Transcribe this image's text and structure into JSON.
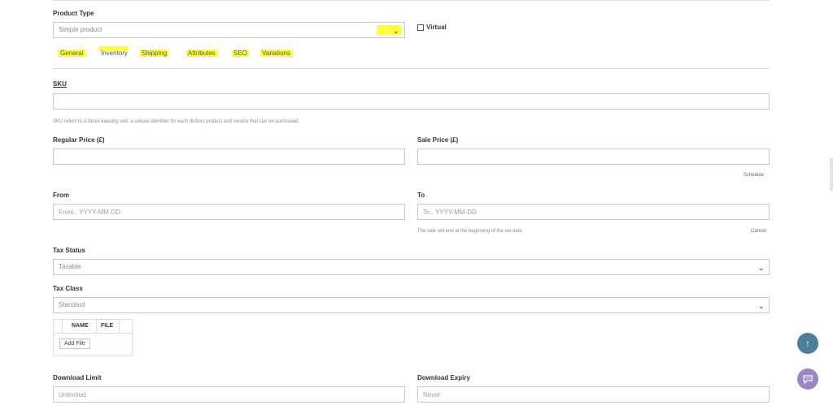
{
  "product_type": {
    "label": "Product Type",
    "value": "Simple product",
    "virtual_label": "Virtual"
  },
  "tabs": [
    "General",
    "Inventory",
    "Shipping",
    "Attributes",
    "SEO",
    "Variations"
  ],
  "sku": {
    "label": "SKU",
    "value": "",
    "help": "SKU refers to a Stock-keeping unit, a unique identifier for each distinct product and service that can be purchased."
  },
  "pricing": {
    "regular_label": "Regular Price (£)",
    "regular_value": "",
    "sale_label": "Sale Price (£)",
    "sale_value": "",
    "schedule_link": "Schedule"
  },
  "schedule": {
    "from_label": "From",
    "from_placeholder": "From.. YYYY-MM-DD",
    "to_label": "To",
    "to_placeholder": "To.. YYYY-MM-DD",
    "note": "The sale will end at the beginning of the set date.",
    "cancel_link": "Cancel"
  },
  "tax": {
    "status_label": "Tax Status",
    "status_value": "Taxable",
    "class_label": "Tax Class",
    "class_value": "Standard"
  },
  "files": {
    "col_name": "NAME",
    "col_file": "FILE",
    "add_button": "Add File"
  },
  "download": {
    "limit_label": "Download Limit",
    "limit_placeholder": "Unlimited",
    "expiry_label": "Download Expiry",
    "expiry_placeholder": "Never"
  },
  "colors": {
    "highlight": "#ffff3c",
    "scroll_top_fab": "#4b7f9b",
    "chat_fab": "#9b86c4"
  },
  "icons": {
    "scroll_top": "arrow-up-icon",
    "chat": "chat-bubble-icon",
    "select": "chevron-down-icon"
  }
}
